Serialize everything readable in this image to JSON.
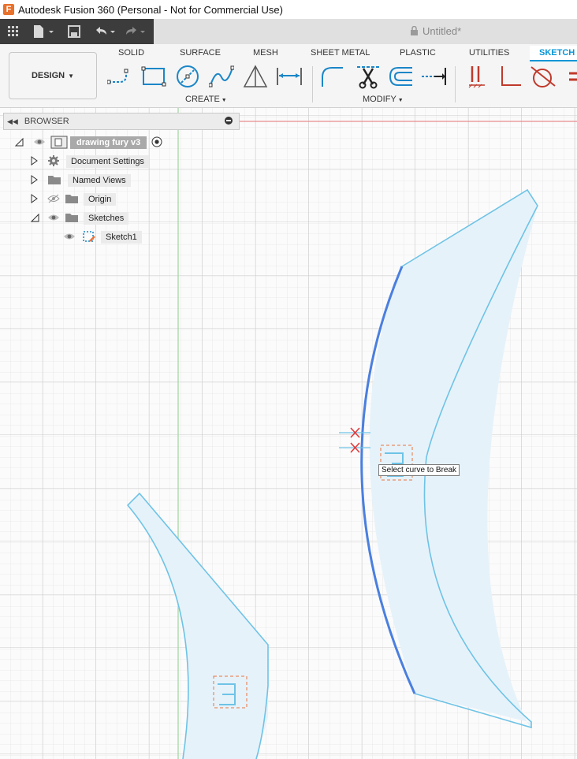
{
  "window": {
    "title": "Autodesk Fusion 360 (Personal - Not for Commercial Use)",
    "logo_letter": "F"
  },
  "quick_access": {
    "document_title": "Untitled*"
  },
  "ribbon": {
    "workspace": "DESIGN",
    "tabs": [
      "SOLID",
      "SURFACE",
      "MESH",
      "SHEET METAL",
      "PLASTIC",
      "UTILITIES",
      "SKETCH"
    ],
    "active_tab": "SKETCH",
    "groups": {
      "create": "CREATE",
      "modify": "MODIFY"
    },
    "create_tools": [
      "line-icon",
      "rectangle-icon",
      "circle-icon",
      "spline-icon",
      "triangle-icon",
      "dimension-icon"
    ],
    "modify_tools": [
      "fillet-icon",
      "trim-icon",
      "offset-icon",
      "extend-icon"
    ],
    "constraint_tools": [
      "parallel-constraint-icon",
      "perpendicular-constraint-icon",
      "tangent-constraint-icon"
    ]
  },
  "browser": {
    "title": "BROWSER",
    "root": "drawing fury v3",
    "items": [
      {
        "label": "Document Settings",
        "icon": "gear-icon"
      },
      {
        "label": "Named Views",
        "icon": "folder-icon"
      },
      {
        "label": "Origin",
        "icon": "folder-icon"
      },
      {
        "label": "Sketches",
        "icon": "folder-icon"
      },
      {
        "label": "Sketch1",
        "icon": "sketch-icon"
      }
    ]
  },
  "canvas": {
    "tooltip": "Select curve to Break"
  },
  "colors": {
    "accent": "#0696d7",
    "sketch_line": "#6ec3e6",
    "selected_curve": "#4a7fe0",
    "profile_fill": "#e6f2fa",
    "grid_minor": "#e4e4e4",
    "grid_major": "#cfcfcf",
    "y_axis": "#9bd49b",
    "x_axis": "#e58c8c"
  }
}
